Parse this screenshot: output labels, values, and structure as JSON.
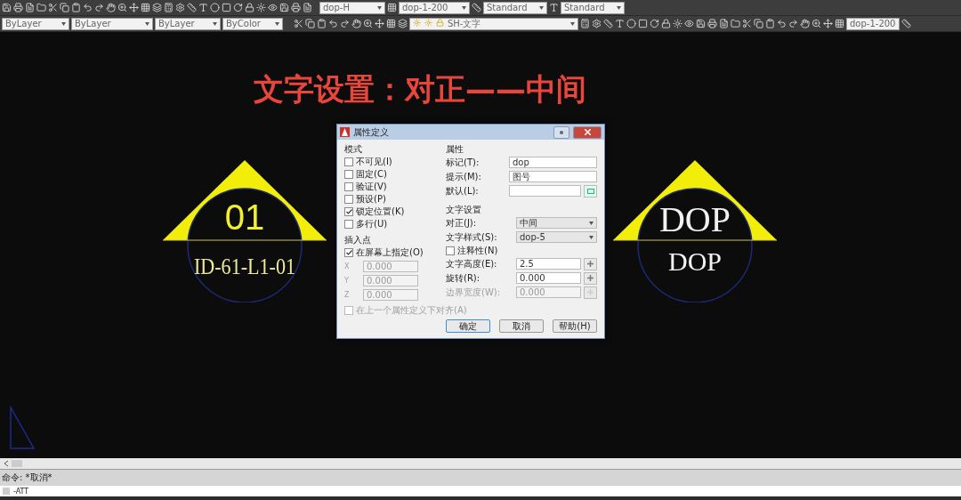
{
  "toolbar": {
    "row1_fields": [
      {
        "value": "dop-H"
      },
      {
        "value": "dop-1-200"
      },
      {
        "value": "Standard"
      },
      {
        "value": "Standard"
      }
    ],
    "row2_fields": [
      {
        "value": "ByLayer"
      },
      {
        "value": "ByLayer"
      },
      {
        "value": "ByLayer"
      },
      {
        "value": "ByColor"
      }
    ],
    "layer_field": {
      "value": "SH-文字"
    },
    "scale_field": {
      "value": "dop-1-200"
    }
  },
  "heading": "文字设置：对正——中间",
  "drawing": {
    "left_symbol": {
      "number": "01",
      "code": "ID-61-L1-01"
    },
    "right_symbol": {
      "top": "DOP",
      "bottom": "DOP"
    }
  },
  "dialog": {
    "title": "属性定义",
    "mode": {
      "title": "模式",
      "options": [
        {
          "label": "不可见(I)",
          "checked": false
        },
        {
          "label": "固定(C)",
          "checked": false
        },
        {
          "label": "验证(V)",
          "checked": false
        },
        {
          "label": "预设(P)",
          "checked": false
        },
        {
          "label": "锁定位置(K)",
          "checked": true
        },
        {
          "label": "多行(U)",
          "checked": false
        }
      ]
    },
    "insertion_point": {
      "title": "插入点",
      "on_screen": {
        "label": "在屏幕上指定(O)",
        "checked": true
      },
      "coords": [
        {
          "axis": "X",
          "value": "0.000",
          "disabled": true
        },
        {
          "axis": "Y",
          "value": "0.000",
          "disabled": true
        },
        {
          "axis": "Z",
          "value": "0.000",
          "disabled": true
        }
      ]
    },
    "attribute": {
      "title": "属性",
      "fields": [
        {
          "label": "标记(T):",
          "value": "dop"
        },
        {
          "label": "提示(M):",
          "value": "图号"
        },
        {
          "label": "默认(L):"
        }
      ]
    },
    "text_settings": {
      "title": "文字设置",
      "rows": [
        {
          "kind": "select",
          "label": "对正(J):",
          "value": "中间",
          "disabled": false
        },
        {
          "kind": "select",
          "label": "文字样式(S):",
          "value": "dop-5",
          "disabled": false
        },
        {
          "kind": "checkbox",
          "label": "注释性(N)",
          "checked": false,
          "disabled": false
        },
        {
          "kind": "input",
          "label": "文字高度(E):",
          "value": "2.5",
          "disabled": false
        },
        {
          "kind": "input",
          "label": "旋转(R):",
          "value": "0.000",
          "disabled": false
        },
        {
          "kind": "input",
          "label": "边界宽度(W):",
          "value": "0.000",
          "disabled": true
        }
      ]
    },
    "align_below": {
      "label": "在上一个属性定义下对齐(A)",
      "checked": false,
      "disabled": true
    },
    "buttons": [
      {
        "label": "确定",
        "selected": true
      },
      {
        "label": "取消",
        "selected": false
      },
      {
        "label": "帮助(H)",
        "selected": false
      }
    ]
  },
  "command_line": {
    "history": "命令: *取消*",
    "input": "-ATT"
  }
}
